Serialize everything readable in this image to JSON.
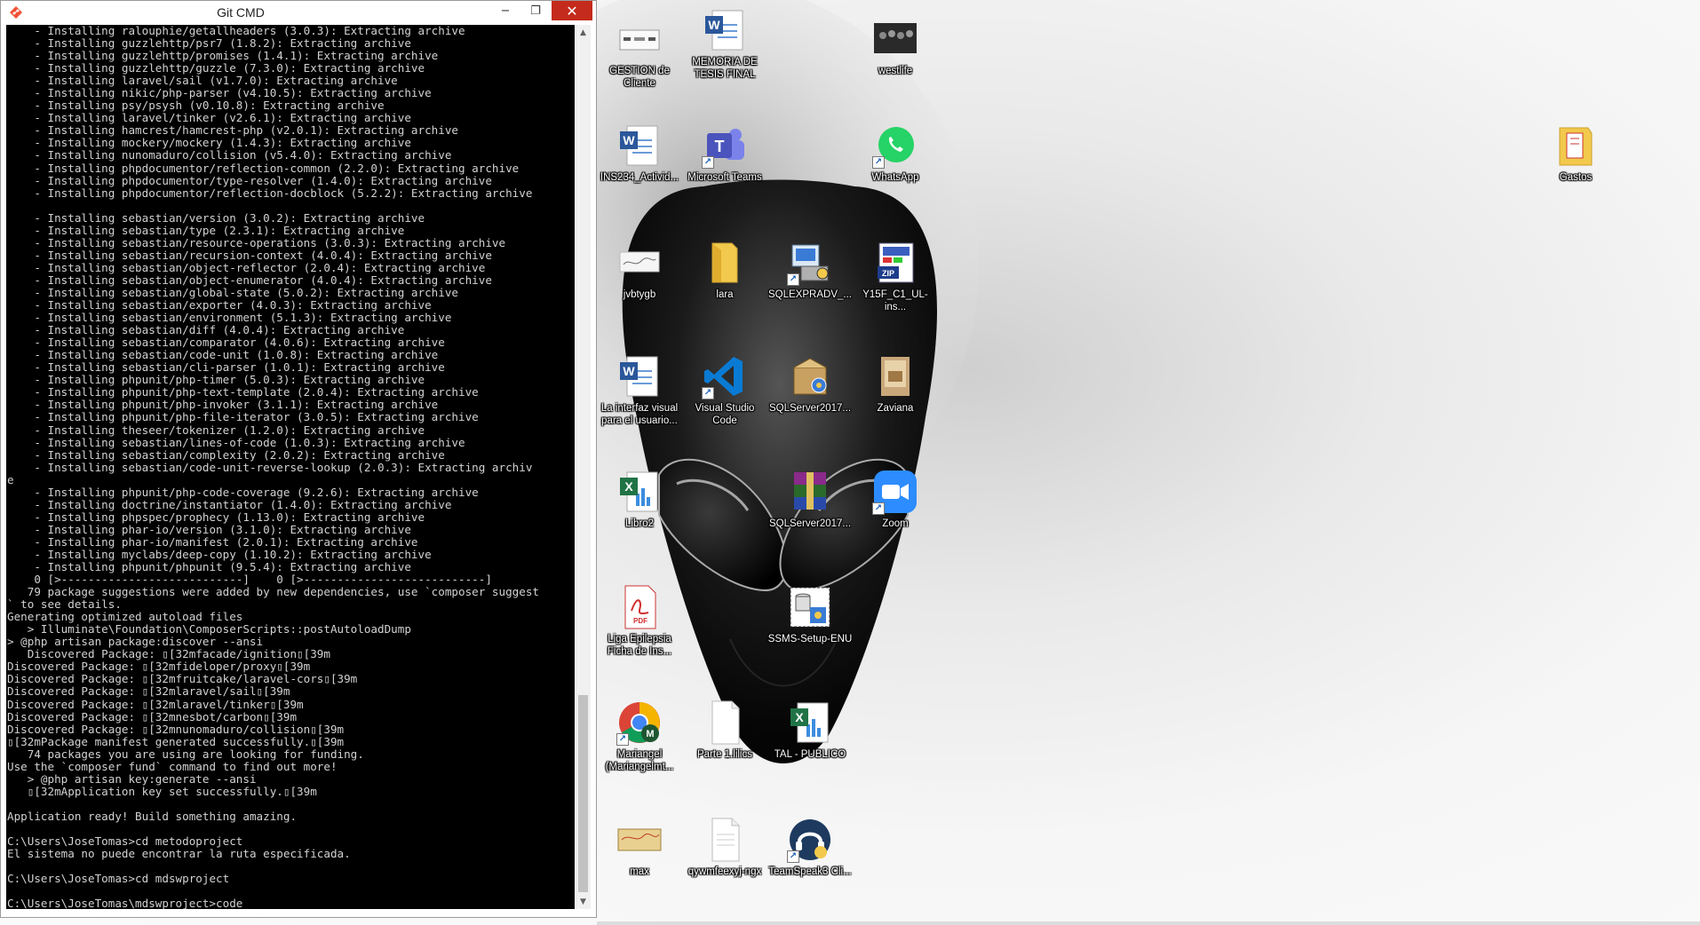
{
  "window": {
    "title": "Git CMD",
    "minimize_label": "−",
    "maximize_label": "❐",
    "close_label": "✕"
  },
  "console": {
    "lines": [
      "    - Installing ralouphie/getallheaders (3.0.3): Extracting archive",
      "    - Installing guzzlehttp/psr7 (1.8.2): Extracting archive",
      "    - Installing guzzlehttp/promises (1.4.1): Extracting archive",
      "    - Installing guzzlehttp/guzzle (7.3.0): Extracting archive",
      "    - Installing laravel/sail (v1.7.0): Extracting archive",
      "    - Installing nikic/php-parser (v4.10.5): Extracting archive",
      "    - Installing psy/psysh (v0.10.8): Extracting archive",
      "    - Installing laravel/tinker (v2.6.1): Extracting archive",
      "    - Installing hamcrest/hamcrest-php (v2.0.1): Extracting archive",
      "    - Installing mockery/mockery (1.4.3): Extracting archive",
      "    - Installing nunomaduro/collision (v5.4.0): Extracting archive",
      "    - Installing phpdocumentor/reflection-common (2.2.0): Extracting archive",
      "    - Installing phpdocumentor/type-resolver (1.4.0): Extracting archive",
      "    - Installing phpdocumentor/reflection-docblock (5.2.2): Extracting archive",
      "",
      "    - Installing sebastian/version (3.0.2): Extracting archive",
      "    - Installing sebastian/type (2.3.1): Extracting archive",
      "    - Installing sebastian/resource-operations (3.0.3): Extracting archive",
      "    - Installing sebastian/recursion-context (4.0.4): Extracting archive",
      "    - Installing sebastian/object-reflector (2.0.4): Extracting archive",
      "    - Installing sebastian/object-enumerator (4.0.4): Extracting archive",
      "    - Installing sebastian/global-state (5.0.2): Extracting archive",
      "    - Installing sebastian/exporter (4.0.3): Extracting archive",
      "    - Installing sebastian/environment (5.1.3): Extracting archive",
      "    - Installing sebastian/diff (4.0.4): Extracting archive",
      "    - Installing sebastian/comparator (4.0.6): Extracting archive",
      "    - Installing sebastian/code-unit (1.0.8): Extracting archive",
      "    - Installing sebastian/cli-parser (1.0.1): Extracting archive",
      "    - Installing phpunit/php-timer (5.0.3): Extracting archive",
      "    - Installing phpunit/php-text-template (2.0.4): Extracting archive",
      "    - Installing phpunit/php-invoker (3.1.1): Extracting archive",
      "    - Installing phpunit/php-file-iterator (3.0.5): Extracting archive",
      "    - Installing theseer/tokenizer (1.2.0): Extracting archive",
      "    - Installing sebastian/lines-of-code (1.0.3): Extracting archive",
      "    - Installing sebastian/complexity (2.0.2): Extracting archive",
      "    - Installing sebastian/code-unit-reverse-lookup (2.0.3): Extracting archiv",
      "e",
      "    - Installing phpunit/php-code-coverage (9.2.6): Extracting archive",
      "    - Installing doctrine/instantiator (1.4.0): Extracting archive",
      "    - Installing phpspec/prophecy (1.13.0): Extracting archive",
      "    - Installing phar-io/version (3.1.0): Extracting archive",
      "    - Installing phar-io/manifest (2.0.1): Extracting archive",
      "    - Installing myclabs/deep-copy (1.10.2): Extracting archive",
      "    - Installing phpunit/phpunit (9.5.4): Extracting archive",
      "    0 [>---------------------------]    0 [>---------------------------]",
      "   79 package suggestions were added by new dependencies, use `composer suggest",
      "` to see details.",
      "Generating optimized autoload files",
      "   > Illuminate\\Foundation\\ComposerScripts::postAutoloadDump",
      "> @php artisan package:discover --ansi",
      "   Discovered Package: ▯[32mfacade/ignition▯[39m",
      "Discovered Package: ▯[32mfideloper/proxy▯[39m",
      "Discovered Package: ▯[32mfruitcake/laravel-cors▯[39m",
      "Discovered Package: ▯[32mlaravel/sail▯[39m",
      "Discovered Package: ▯[32mlaravel/tinker▯[39m",
      "Discovered Package: ▯[32mnesbot/carbon▯[39m",
      "Discovered Package: ▯[32mnunomaduro/collision▯[39m",
      "▯[32mPackage manifest generated successfully.▯[39m",
      "   74 packages you are using are looking for funding.",
      "Use the `composer fund` command to find out more!",
      "   > @php artisan key:generate --ansi",
      "   ▯[32mApplication key set successfully.▯[39m",
      "",
      "Application ready! Build something amazing.",
      "",
      "C:\\Users\\JoseTomas>cd metodoproject",
      "El sistema no puede encontrar la ruta especificada.",
      "",
      "C:\\Users\\JoseTomas>cd mdswproject",
      "",
      "C:\\Users\\JoseTomas\\mdswproject>code"
    ]
  },
  "desktop_icons": [
    {
      "label": "GESTION de Cliente",
      "icon": "document-thumbnail-icon"
    },
    {
      "label": "MEMORIA DE TESIS FINAL",
      "icon": "word-document-icon"
    },
    {
      "label": "westlife",
      "icon": "photo-thumbnail-icon"
    },
    {
      "label": "INS234_Activid...",
      "icon": "word-document-icon"
    },
    {
      "label": "Microsoft Teams",
      "icon": "teams-icon"
    },
    {
      "label": "WhatsApp",
      "icon": "whatsapp-icon"
    },
    {
      "label": "Gastos",
      "icon": "folder-icon"
    },
    {
      "label": "jvbtygb",
      "icon": "image-thumbnail-icon"
    },
    {
      "label": "lara",
      "icon": "folder-icon"
    },
    {
      "label": "SQLEXPRADV_...",
      "icon": "installer-icon"
    },
    {
      "label": "Y15F_C1_UL-ins...",
      "icon": "zip-archive-icon"
    },
    {
      "label": "La interfaz visual para el usuario...",
      "icon": "word-document-icon"
    },
    {
      "label": "Visual Studio Code",
      "icon": "vscode-icon"
    },
    {
      "label": "SQLServer2017...",
      "icon": "setup-box-icon"
    },
    {
      "label": "Zaviana",
      "icon": "photo-thumbnail-icon"
    },
    {
      "label": "Libro2",
      "icon": "excel-document-icon"
    },
    {
      "label": "SQLServer2017...",
      "icon": "winrar-archive-icon"
    },
    {
      "label": "Zoom",
      "icon": "zoom-icon"
    },
    {
      "label": "Liga Epilepsia Ficha de Ins...",
      "icon": "pdf-document-icon"
    },
    {
      "label": "SSMS-Setup-ENU",
      "icon": "installer-icon"
    },
    {
      "label": "Mariangel (Mariangelmt...",
      "icon": "chrome-icon"
    },
    {
      "label": "Parte 1.lilics",
      "icon": "blank-document-icon"
    },
    {
      "label": "TAL - PUBLICO",
      "icon": "excel-document-icon"
    },
    {
      "label": "max",
      "icon": "map-thumbnail-icon"
    },
    {
      "label": "qywmfeexyj-ngx",
      "icon": "blank-document-icon"
    },
    {
      "label": "TeamSpeak3 Cli...",
      "icon": "teamspeak-icon"
    }
  ],
  "colors": {
    "console_bg": "#000000",
    "console_fg": "#d2d2d2",
    "close_button": "#c42b1c"
  }
}
